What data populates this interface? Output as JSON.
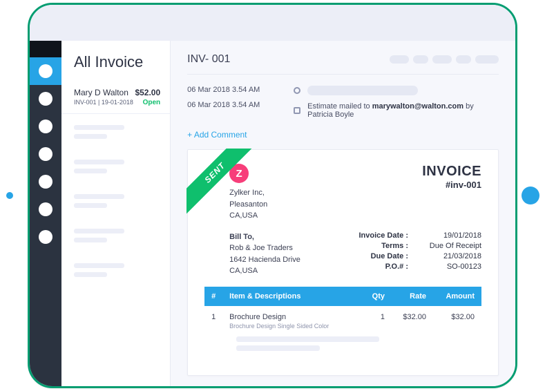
{
  "list": {
    "title": "All Invoice",
    "item": {
      "customer": "Mary D Walton",
      "amount": "$52.00",
      "id": "INV-001",
      "date": "19-01-2018",
      "status": "Open"
    }
  },
  "main": {
    "title": "INV- 001",
    "timeline": {
      "date1": "06 Mar 2018 3.54 AM",
      "date2": "06 Mar 2018 3.54 AM",
      "event_prefix": "Estimate mailed to ",
      "event_email": "marywalton@walton.com",
      "event_suffix": " by Patricia Boyle"
    },
    "add_comment": "+ Add Comment"
  },
  "invoice": {
    "ribbon": "SENT",
    "logo_letter": "Z",
    "from": {
      "name": "Zylker Inc,",
      "city": "Pleasanton",
      "region": "CA,USA"
    },
    "label": "INVOICE",
    "number": "#inv-001",
    "bill_to": {
      "heading": "Bill To,",
      "name": "Rob & Joe Traders",
      "addr": "1642 Hacienda Drive",
      "region": "CA,USA"
    },
    "meta": {
      "invoice_date_k": "Invoice Date :",
      "invoice_date_v": "19/01/2018",
      "terms_k": "Terms :",
      "terms_v": "Due Of Receipt",
      "due_date_k": "Due Date :",
      "due_date_v": "21/03/2018",
      "po_k": "P.O.# :",
      "po_v": "SO-00123"
    },
    "columns": {
      "num": "#",
      "desc": "Item & Descriptions",
      "qty": "Qty",
      "rate": "Rate",
      "amount": "Amount"
    },
    "row": {
      "num": "1",
      "item": "Brochure Design",
      "sub": "Brochure Design Single Sided Color",
      "qty": "1",
      "rate": "$32.00",
      "amount": "$32.00"
    }
  }
}
